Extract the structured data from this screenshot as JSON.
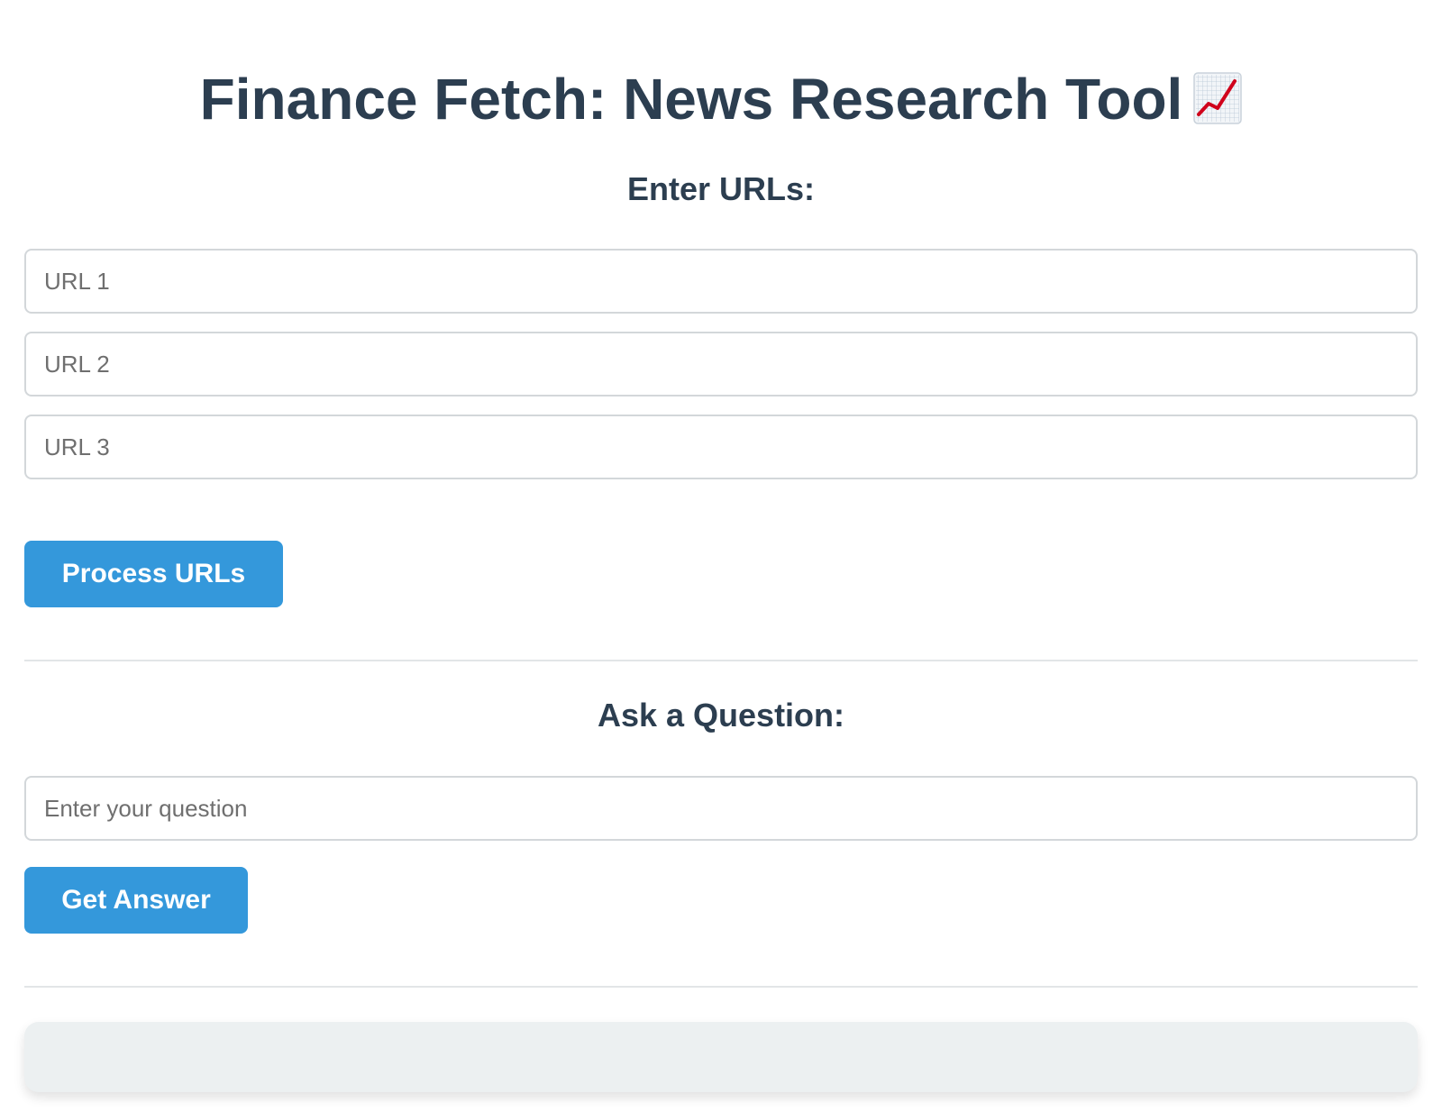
{
  "header": {
    "title": "Finance Fetch: News Research Tool",
    "title_icon": "chart-increasing-icon"
  },
  "url_section": {
    "heading": "Enter URLs:",
    "inputs": [
      {
        "placeholder": "URL 1",
        "value": ""
      },
      {
        "placeholder": "URL 2",
        "value": ""
      },
      {
        "placeholder": "URL 3",
        "value": ""
      }
    ],
    "process_button_label": "Process URLs"
  },
  "question_section": {
    "heading": "Ask a Question:",
    "input": {
      "placeholder": "Enter your question",
      "value": ""
    },
    "answer_button_label": "Get Answer"
  },
  "result": {
    "text": ""
  },
  "colors": {
    "accent": "#3498db",
    "heading": "#2c3e50",
    "result_background": "#ecf0f1",
    "icon_line": "#d0021b"
  }
}
